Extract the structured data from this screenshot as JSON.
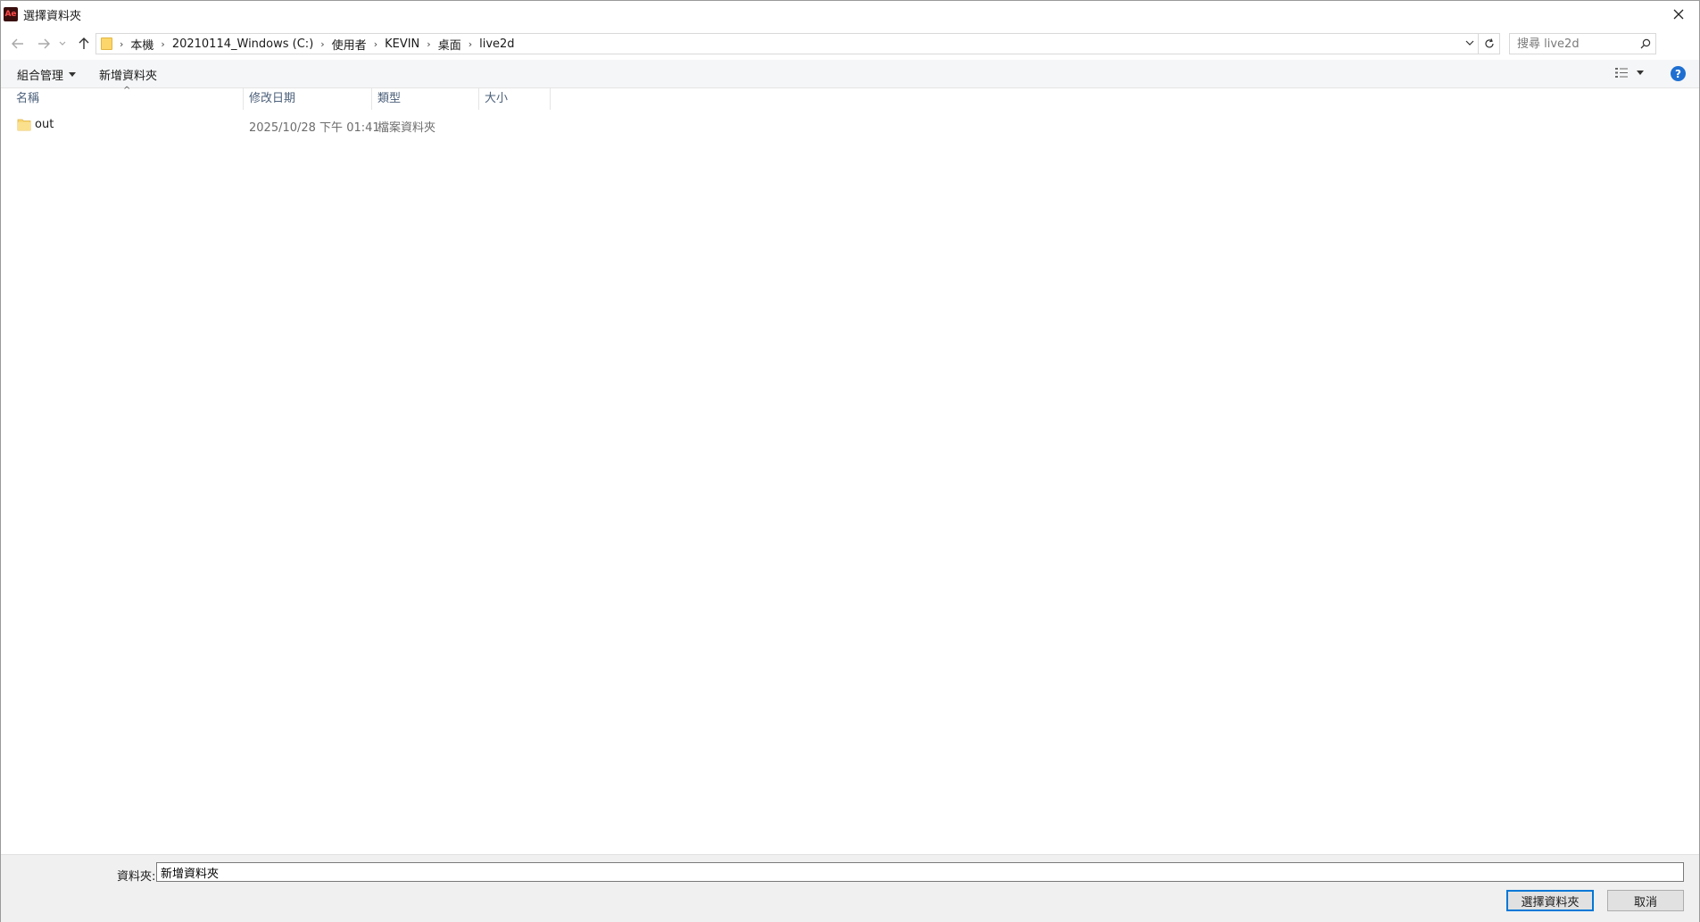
{
  "window": {
    "title": "選擇資料夾"
  },
  "address": {
    "crumbs": [
      "本機",
      "20210114_Windows (C:)",
      "使用者",
      "KEVIN",
      "桌面",
      "live2d"
    ]
  },
  "search": {
    "placeholder": "搜尋 live2d"
  },
  "toolbar": {
    "organize_label": "組合管理",
    "new_folder_label": "新增資料夾"
  },
  "columns": {
    "name": "名稱",
    "modified": "修改日期",
    "type": "類型",
    "size": "大小"
  },
  "files": [
    {
      "name": "out",
      "modified": "2025/10/28 下午 01:41",
      "type": "檔案資料夾",
      "size": ""
    }
  ],
  "footer": {
    "folder_label": "資料夾:",
    "folder_value": "新增資料夾",
    "select_button": "選擇資料夾",
    "cancel_button": "取消"
  }
}
